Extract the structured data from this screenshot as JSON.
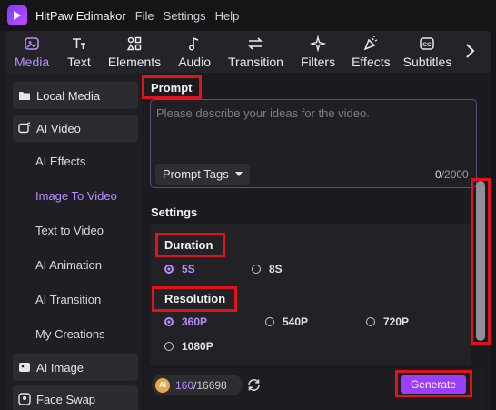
{
  "app": {
    "title": "HitPaw Edimakor"
  },
  "menu": [
    "File",
    "Settings",
    "Help"
  ],
  "toolbar": {
    "tabs": [
      {
        "label": "Media",
        "icon": "media-icon",
        "active": true
      },
      {
        "label": "Text",
        "icon": "text-icon"
      },
      {
        "label": "Elements",
        "icon": "elements-icon"
      },
      {
        "label": "Audio",
        "icon": "audio-icon"
      },
      {
        "label": "Transition",
        "icon": "transition-icon"
      },
      {
        "label": "Filters",
        "icon": "filters-icon"
      },
      {
        "label": "Effects",
        "icon": "effects-icon"
      },
      {
        "label": "Subtitles",
        "icon": "subtitles-icon"
      }
    ],
    "next_icon": "chevron-right-icon"
  },
  "sidebar": {
    "local_media": "Local Media",
    "ai_video": "AI Video",
    "sub_items": [
      "AI Effects",
      "Image To Video",
      "Text to Video",
      "AI Animation",
      "AI Transition",
      "My Creations"
    ],
    "active_sub": "Image To Video",
    "ai_image": "AI Image",
    "face_swap": "Face Swap"
  },
  "prompt": {
    "title": "Prompt",
    "placeholder": "Please describe your ideas for the video.",
    "tags_label": "Prompt Tags",
    "count_current": "0",
    "count_max": "/2000"
  },
  "settings": {
    "title": "Settings",
    "duration_label": "Duration",
    "durations": [
      "5S",
      "8S"
    ],
    "duration_selected": "5S",
    "resolution_label": "Resolution",
    "resolutions": [
      "360P",
      "540P",
      "720P",
      "1080P"
    ],
    "resolution_selected": "360P"
  },
  "footer": {
    "credits_used": "160",
    "credits_total": "/16698",
    "coin_label": "AI",
    "generate_label": "Generate"
  },
  "colors": {
    "accent": "#b98cff",
    "generate": "#9a3fff",
    "highlight": "#e0131c"
  }
}
